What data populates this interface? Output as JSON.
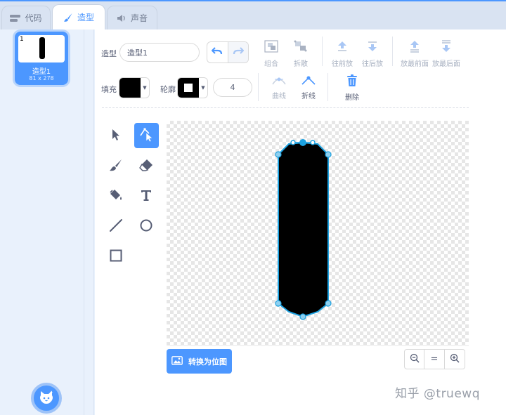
{
  "tabs": [
    {
      "label": "代码",
      "icon": "code-icon",
      "active": false
    },
    {
      "label": "造型",
      "icon": "paintbrush-icon",
      "active": true
    },
    {
      "label": "声音",
      "icon": "speaker-icon",
      "active": false
    }
  ],
  "costumes": [
    {
      "index": "1",
      "name": "造型1",
      "size": "81 x 278",
      "selected": true
    }
  ],
  "editor": {
    "costume_label": "造型",
    "costume_name": "造型1",
    "toolbar": {
      "group": "组合",
      "ungroup": "拆散",
      "forward": "往前放",
      "backward": "往后放",
      "front": "放最前面",
      "back": "放最后面"
    },
    "fill_label": "填充",
    "fill_color": "#000000",
    "outline_label": "轮廓",
    "outline_color": "#000000",
    "outline_width": "4",
    "curve": "曲线",
    "polyline": "折线",
    "delete": "删除",
    "convert_button": "转换为位图",
    "zoom": {
      "out": "zoom-out-icon",
      "reset": "=",
      "in": "zoom-in-icon"
    }
  },
  "tools": [
    {
      "name": "select-tool",
      "icon": "arrow-icon",
      "selected": false
    },
    {
      "name": "reshape-tool",
      "icon": "reshape-icon",
      "selected": true
    },
    {
      "name": "brush-tool",
      "icon": "brush-icon",
      "selected": false
    },
    {
      "name": "eraser-tool",
      "icon": "eraser-icon",
      "selected": false
    },
    {
      "name": "fill-tool",
      "icon": "bucket-icon",
      "selected": false
    },
    {
      "name": "text-tool",
      "icon": "text-icon",
      "selected": false
    },
    {
      "name": "line-tool",
      "icon": "line-icon",
      "selected": false
    },
    {
      "name": "circle-tool",
      "icon": "circle-icon",
      "selected": false
    },
    {
      "name": "rect-tool",
      "icon": "rect-icon",
      "selected": false
    }
  ],
  "colors": {
    "accent": "#4c97ff",
    "selection": "#1ca1e0",
    "shape": "#000000"
  },
  "watermark": "知乎 @truewq"
}
